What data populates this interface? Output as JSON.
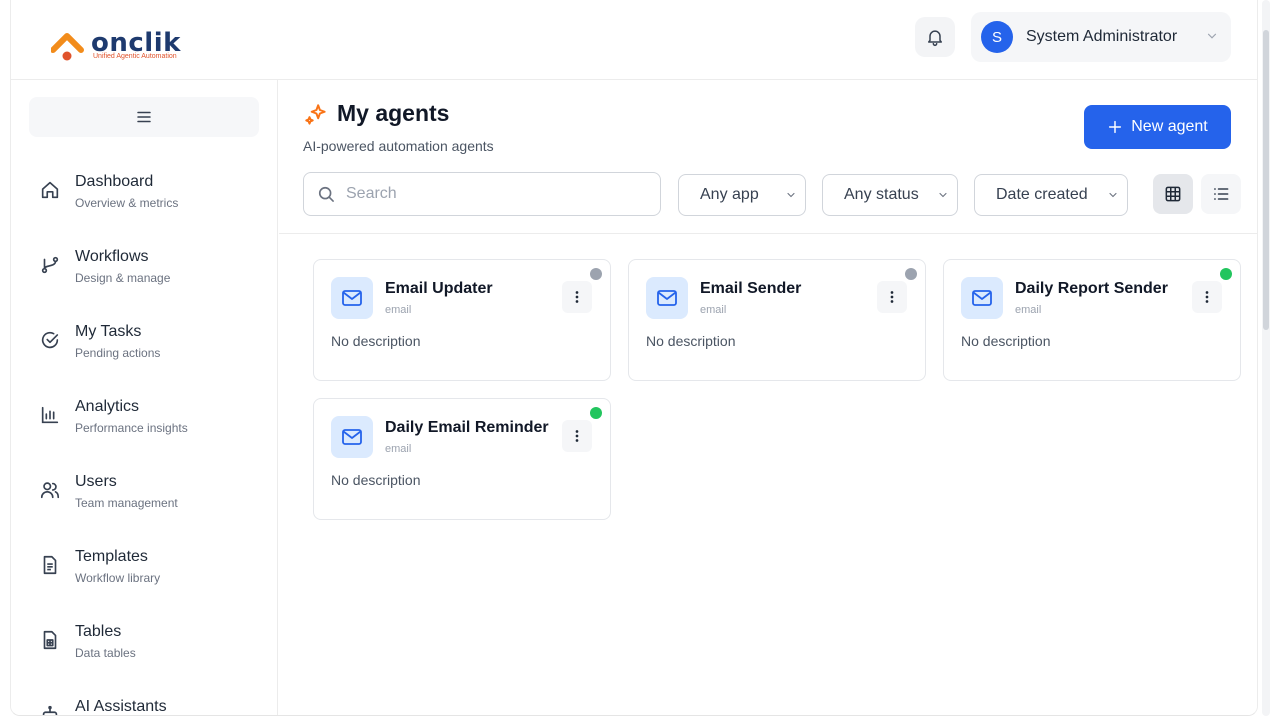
{
  "brand": {
    "name": "onclik",
    "tagline": "Unified Agentic Automation",
    "text_color": "#1e3a6e",
    "mark_color_orange": "#f28c1b",
    "mark_color_red": "#e0532c"
  },
  "header": {
    "notifications_icon": "bell-icon",
    "user": {
      "initial": "S",
      "name": "System Administrator",
      "avatar_color": "#2563eb"
    }
  },
  "sidebar": {
    "toggle_icon": "hamburger-icon",
    "items": [
      {
        "label": "Dashboard",
        "sublabel": "Overview & metrics",
        "icon": "home-icon"
      },
      {
        "label": "Workflows",
        "sublabel": "Design & manage",
        "icon": "branch-icon"
      },
      {
        "label": "My Tasks",
        "sublabel": "Pending actions",
        "icon": "check-circle-icon"
      },
      {
        "label": "Analytics",
        "sublabel": "Performance insights",
        "icon": "bar-chart-icon"
      },
      {
        "label": "Users",
        "sublabel": "Team management",
        "icon": "users-icon"
      },
      {
        "label": "Templates",
        "sublabel": "Workflow library",
        "icon": "document-icon"
      },
      {
        "label": "Tables",
        "sublabel": "Data tables",
        "icon": "table-file-icon"
      },
      {
        "label": "AI Assistants",
        "sublabel": "",
        "icon": "robot-icon"
      }
    ]
  },
  "main": {
    "title": "My agents",
    "title_icon": "sparkles-icon",
    "subtitle": "AI-powered automation agents",
    "new_agent_label": "New agent",
    "accent": "#2563eb",
    "filters": {
      "search_placeholder": "Search",
      "app": "Any app",
      "status": "Any status",
      "sort": "Date created"
    },
    "view_modes": [
      "grid",
      "list"
    ],
    "active_view": "grid",
    "agents": [
      {
        "name": "Email Updater",
        "type": "email",
        "description": "No description",
        "status_color": "#9ca3af"
      },
      {
        "name": "Email Sender",
        "type": "email",
        "description": "No description",
        "status_color": "#9ca3af"
      },
      {
        "name": "Daily Report Sender",
        "type": "email",
        "description": "No description",
        "status_color": "#22c55e"
      },
      {
        "name": "Daily Email Reminder",
        "type": "email",
        "description": "No description",
        "status_color": "#22c55e"
      }
    ]
  }
}
